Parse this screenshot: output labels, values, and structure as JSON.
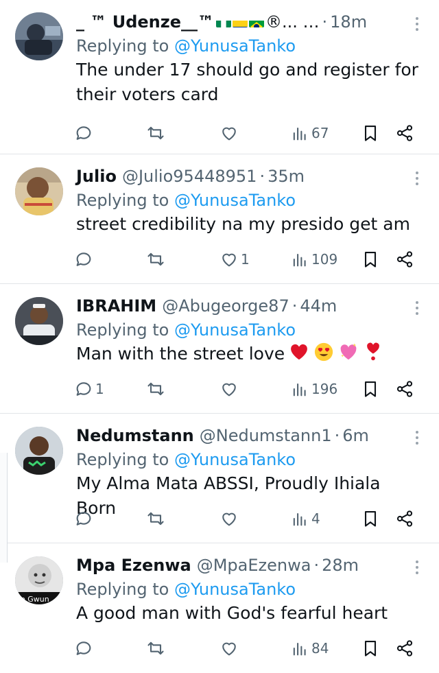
{
  "tweets": [
    {
      "name": "_ ™ Udenze__™",
      "after_flags": "®... …",
      "handle": "",
      "time": "18m",
      "replying_prefix": "Replying to",
      "replying_to": "@YunusaTanko",
      "text": "The under 17 should go and register for their voters card",
      "stats": {
        "replies": "",
        "retweets": "",
        "likes": "",
        "views": "67"
      }
    },
    {
      "name": "Julio",
      "handle": "@Julio95448951",
      "time": "35m",
      "replying_prefix": "Replying to",
      "replying_to": "@YunusaTanko",
      "text": "street credibility na my presido get am",
      "stats": {
        "replies": "",
        "retweets": "",
        "likes": "1",
        "views": "109"
      }
    },
    {
      "name": "IBRAHIM",
      "handle": "@Abugeorge87",
      "time": "44m",
      "replying_prefix": "Replying to",
      "replying_to": "@YunusaTanko",
      "text": "Man with the street love",
      "emojis": [
        "red-heart",
        "heart-eyes",
        "sparkling-heart",
        "heart-exclamation"
      ],
      "stats": {
        "replies": "1",
        "retweets": "",
        "likes": "",
        "views": "196"
      }
    },
    {
      "name": "Nedumstann",
      "handle": "@Nedumstann1",
      "time": "6m",
      "replying_prefix": "Replying to",
      "replying_to": "@YunusaTanko",
      "text": "My Alma Mata ABSSI, Proudly Ihiala Born",
      "stats": {
        "replies": "",
        "retweets": "",
        "likes": "",
        "views": "4"
      }
    },
    {
      "name": "Mpa Ezenwa",
      "handle": "@MpaEzenwa",
      "time": "28m",
      "replying_prefix": "Replying to",
      "replying_to": "@YunusaTanko",
      "text": "A good man with God's fearful heart",
      "avatar_text": "ke Gwun",
      "stats": {
        "replies": "",
        "retweets": "",
        "likes": "",
        "views": "84"
      }
    }
  ],
  "colors": {
    "link": "#1d9bf0",
    "secondary_text": "#536471",
    "primary_text": "#0f1419",
    "divider": "#e1e4e8"
  },
  "icons": {
    "reply": "speech-bubble-icon",
    "retweet": "retweet-arrows-icon",
    "like": "heart-outline-icon",
    "views": "bar-chart-icon",
    "bookmark": "bookmark-icon",
    "share": "share-nodes-icon",
    "more": "vertical-dots-icon"
  }
}
